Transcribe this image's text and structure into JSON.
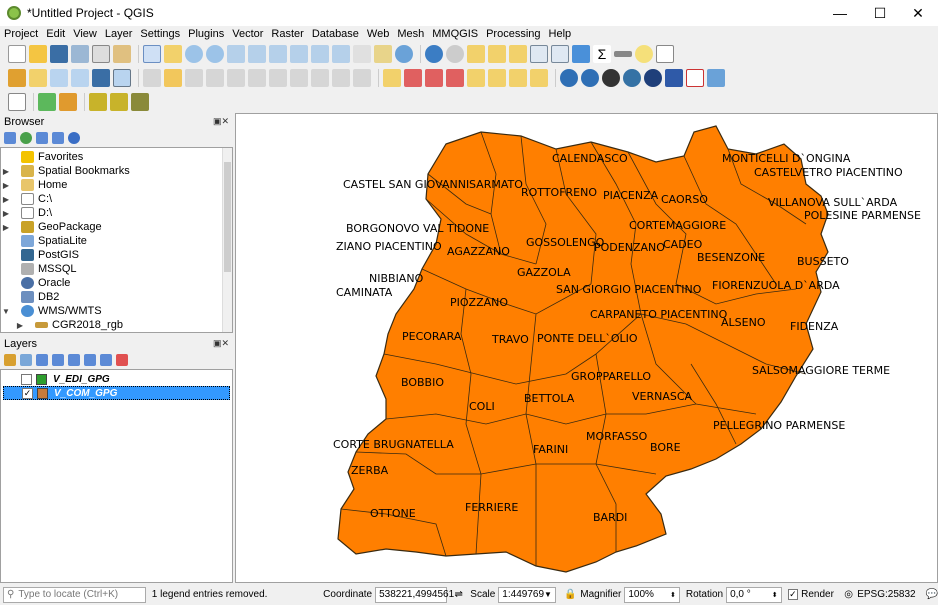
{
  "window": {
    "title": "*Untitled Project - QGIS",
    "minimize": "—",
    "maximize": "☐",
    "close": "✕"
  },
  "menu": [
    "Project",
    "Edit",
    "View",
    "Layer",
    "Settings",
    "Plugins",
    "Vector",
    "Raster",
    "Database",
    "Web",
    "Mesh",
    "MMQGIS",
    "Processing",
    "Help"
  ],
  "browser": {
    "title": "Browser",
    "items": [
      {
        "label": "Favorites",
        "icon": "star-icon"
      },
      {
        "label": "Spatial Bookmarks",
        "icon": "bookmark-icon"
      },
      {
        "label": "Home",
        "icon": "folder-icon"
      },
      {
        "label": "C:\\",
        "icon": "drive-icon"
      },
      {
        "label": "D:\\",
        "icon": "drive-icon"
      },
      {
        "label": "GeoPackage",
        "icon": "geopackage-icon"
      },
      {
        "label": "SpatiaLite",
        "icon": "spatialite-icon"
      },
      {
        "label": "PostGIS",
        "icon": "postgis-icon"
      },
      {
        "label": "MSSQL",
        "icon": "mssql-icon"
      },
      {
        "label": "Oracle",
        "icon": "oracle-icon"
      },
      {
        "label": "DB2",
        "icon": "db2-icon"
      },
      {
        "label": "WMS/WMTS",
        "icon": "wms-icon"
      },
      {
        "label": "CGR2018_rgb",
        "icon": "raster-layer-icon"
      }
    ]
  },
  "layers": {
    "title": "Layers",
    "items": [
      {
        "name": "V_EDI_GPG",
        "checked": false,
        "color": "#2e9e2e"
      },
      {
        "name": "V_COM_GPG",
        "checked": true,
        "color": "#c97b3a"
      }
    ]
  },
  "map": {
    "fill_color": "#ff7f00",
    "labels": [
      "CALENDASCO",
      "MONTICELLI D`ONGINA",
      "CASTELVETRO PIACENTINO",
      "CASTEL SAN GIOVANNI",
      "SARMATO",
      "ROTTOFRENO",
      "PIACENZA",
      "CAORSO",
      "VILLANOVA SULL`ARDA",
      "POLESINE PARMENSE",
      "BORGONOVO VAL TIDONE",
      "CORTEMAGGIORE",
      "ZIANO PIACENTINO",
      "AGAZZANO",
      "GOSSOLENGO",
      "PODENZANO",
      "CADEO",
      "BESENZONE",
      "BUSSETO",
      "NIBBIANO",
      "GAZZOLA",
      "CAMINATA",
      "SAN GIORGIO PIACENTINO",
      "FIORENZUOLA D`ARDA",
      "PIOZZANO",
      "CARPANETO PIACENTINO",
      "ALSENO",
      "FIDENZA",
      "PECORARA",
      "TRAVO",
      "PONTE DELL`OLIO",
      "GROPPARELLO",
      "SALSOMAGGIORE TERME",
      "BOBBIO",
      "BETTOLA",
      "VERNASCA",
      "COLI",
      "PELLEGRINO PARMENSE",
      "MORFASSO",
      "CORTE BRUGNATELLA",
      "FARINI",
      "BORE",
      "ZERBA",
      "FERRIERE",
      "OTTONE",
      "BARDI"
    ]
  },
  "status": {
    "locator_placeholder": "Type to locate (Ctrl+K)",
    "message": "1 legend entries removed.",
    "coordinate_label": "Coordinate",
    "coordinate_value": "538221,4994561",
    "scale_label": "Scale",
    "scale_value": "1:449769",
    "magnifier_label": "Magnifier",
    "magnifier_value": "100%",
    "rotation_label": "Rotation",
    "rotation_value": "0,0 °",
    "render_label": "Render",
    "crs": "EPSG:25832"
  }
}
